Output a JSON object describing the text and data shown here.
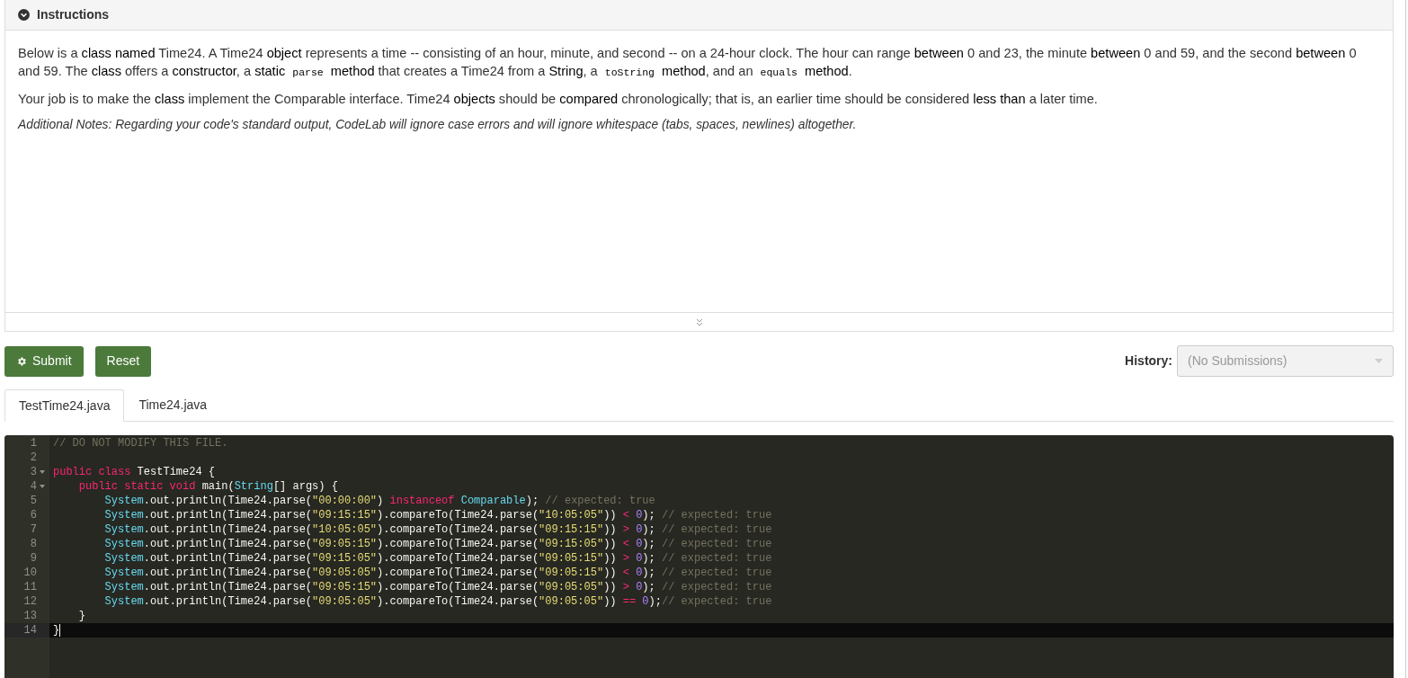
{
  "instructions": {
    "title": "Instructions",
    "paragraphs": [
      {
        "italic": false,
        "segments": [
          {
            "kind": "text",
            "text": "Below is a **class named** Time24. A Time24 **object** represents a time -- consisting of an hour, minute, and second -- on a 24-hour clock. The hour can range **between** 0 and 23, the minute **between** 0 and 59, and the second **between** 0 and 59. The **class** offers a **constructor**, a **static** "
          },
          {
            "kind": "code",
            "text": "parse"
          },
          {
            "kind": "text",
            "text": " **method** that creates a Time24 from a **String**, a "
          },
          {
            "kind": "code",
            "text": "toString"
          },
          {
            "kind": "text",
            "text": " **method**, and an "
          },
          {
            "kind": "code",
            "text": "equals"
          },
          {
            "kind": "text",
            "text": " **method**."
          }
        ]
      },
      {
        "italic": false,
        "segments": [
          {
            "kind": "text",
            "text": "Your job is to make the **class** implement the Comparable interface. Time24 **objects** should be **compared** chronologically; that is, an earlier time should be considered **less than** a later time."
          }
        ]
      },
      {
        "italic": true,
        "segments": [
          {
            "kind": "text",
            "text": "Additional Notes: Regarding your code's standard output, CodeLab will ignore case errors and will ignore whitespace (tabs, spaces, newlines) altogether."
          }
        ]
      }
    ]
  },
  "buttons": [
    {
      "label": "Submit",
      "kind": "gear"
    },
    {
      "label": "Reset",
      "kind": "plain"
    }
  ],
  "history": {
    "label": "History:",
    "placeholder": "(No Submissions)",
    "disabled": true
  },
  "tabs": [
    {
      "label": "TestTime24.java",
      "selected": true
    },
    {
      "label": "Time24.java",
      "selected": false
    }
  ],
  "editor": {
    "lines": [
      {
        "number": "1",
        "fold": false,
        "active": false,
        "tokens": [
          {
            "t": "// DO NOT MODIFY THIS FILE.",
            "kind": "comment"
          }
        ]
      },
      {
        "number": "2",
        "fold": false,
        "active": false
      },
      {
        "number": "3",
        "fold": true,
        "active": false,
        "tokens": [
          {
            "t": "public class",
            "kind": "keyword"
          },
          {
            "t": " TestTime24 {",
            "kind": "plain"
          }
        ]
      },
      {
        "number": "4",
        "fold": true,
        "active": false,
        "tokens": [
          {
            "t": "    public static void",
            "kind": "keyword"
          },
          {
            "t": " main(",
            "kind": "plain"
          },
          {
            "t": "String",
            "kind": "type"
          },
          {
            "t": "[] args) {",
            "kind": "plain"
          }
        ]
      },
      {
        "number": "5",
        "fold": false,
        "active": false,
        "tokens": [
          {
            "t": "        System",
            "kind": "type"
          },
          {
            "t": ".out.println(Time24.parse(",
            "kind": "plain"
          },
          {
            "t": "\"00:00:00\"",
            "kind": "string"
          },
          {
            "t": ") ",
            "kind": "plain"
          },
          {
            "t": "instanceof ",
            "kind": "keyword"
          },
          {
            "t": "Comparable",
            "kind": "type"
          },
          {
            "t": "); ",
            "kind": "plain"
          },
          {
            "t": "// expected: true",
            "kind": "comment"
          }
        ]
      },
      {
        "number": "6",
        "fold": false,
        "active": false,
        "tokens": [
          {
            "t": "        System",
            "kind": "type"
          },
          {
            "t": ".out.println(Time24.parse(",
            "kind": "plain"
          },
          {
            "t": "\"09:15:15\"",
            "kind": "string"
          },
          {
            "t": ").compareTo(Time24.parse(",
            "kind": "plain"
          },
          {
            "t": "\"10:05:05\"",
            "kind": "string"
          },
          {
            "t": ")) ",
            "kind": "plain"
          },
          {
            "t": "< ",
            "kind": "keyword"
          },
          {
            "t": "0",
            "kind": "number"
          },
          {
            "t": "); ",
            "kind": "plain"
          },
          {
            "t": "// expected: true",
            "kind": "comment"
          }
        ]
      },
      {
        "number": "7",
        "fold": false,
        "active": false,
        "tokens": [
          {
            "t": "        System",
            "kind": "type"
          },
          {
            "t": ".out.println(Time24.parse(",
            "kind": "plain"
          },
          {
            "t": "\"10:05:05\"",
            "kind": "string"
          },
          {
            "t": ").compareTo(Time24.parse(",
            "kind": "plain"
          },
          {
            "t": "\"09:15:15\"",
            "kind": "string"
          },
          {
            "t": ")) ",
            "kind": "plain"
          },
          {
            "t": "> ",
            "kind": "keyword"
          },
          {
            "t": "0",
            "kind": "number"
          },
          {
            "t": "); ",
            "kind": "plain"
          },
          {
            "t": "// expected: true",
            "kind": "comment"
          }
        ]
      },
      {
        "number": "8",
        "fold": false,
        "active": false,
        "tokens": [
          {
            "t": "        System",
            "kind": "type"
          },
          {
            "t": ".out.println(Time24.parse(",
            "kind": "plain"
          },
          {
            "t": "\"09:05:15\"",
            "kind": "string"
          },
          {
            "t": ").compareTo(Time24.parse(",
            "kind": "plain"
          },
          {
            "t": "\"09:15:05\"",
            "kind": "string"
          },
          {
            "t": ")) ",
            "kind": "plain"
          },
          {
            "t": "< ",
            "kind": "keyword"
          },
          {
            "t": "0",
            "kind": "number"
          },
          {
            "t": "); ",
            "kind": "plain"
          },
          {
            "t": "// expected: true",
            "kind": "comment"
          }
        ]
      },
      {
        "number": "9",
        "fold": false,
        "active": false,
        "tokens": [
          {
            "t": "        System",
            "kind": "type"
          },
          {
            "t": ".out.println(Time24.parse(",
            "kind": "plain"
          },
          {
            "t": "\"09:15:05\"",
            "kind": "string"
          },
          {
            "t": ").compareTo(Time24.parse(",
            "kind": "plain"
          },
          {
            "t": "\"09:05:15\"",
            "kind": "string"
          },
          {
            "t": ")) ",
            "kind": "plain"
          },
          {
            "t": "> ",
            "kind": "keyword"
          },
          {
            "t": "0",
            "kind": "number"
          },
          {
            "t": "); ",
            "kind": "plain"
          },
          {
            "t": "// expected: true",
            "kind": "comment"
          }
        ]
      },
      {
        "number": "10",
        "fold": false,
        "active": false,
        "tokens": [
          {
            "t": "        System",
            "kind": "type"
          },
          {
            "t": ".out.println(Time24.parse(",
            "kind": "plain"
          },
          {
            "t": "\"09:05:05\"",
            "kind": "string"
          },
          {
            "t": ").compareTo(Time24.parse(",
            "kind": "plain"
          },
          {
            "t": "\"09:05:15\"",
            "kind": "string"
          },
          {
            "t": ")) ",
            "kind": "plain"
          },
          {
            "t": "< ",
            "kind": "keyword"
          },
          {
            "t": "0",
            "kind": "number"
          },
          {
            "t": "); ",
            "kind": "plain"
          },
          {
            "t": "// expected: true",
            "kind": "comment"
          }
        ]
      },
      {
        "number": "11",
        "fold": false,
        "active": false,
        "tokens": [
          {
            "t": "        System",
            "kind": "type"
          },
          {
            "t": ".out.println(Time24.parse(",
            "kind": "plain"
          },
          {
            "t": "\"09:05:15\"",
            "kind": "string"
          },
          {
            "t": ").compareTo(Time24.parse(",
            "kind": "plain"
          },
          {
            "t": "\"09:05:05\"",
            "kind": "string"
          },
          {
            "t": ")) ",
            "kind": "plain"
          },
          {
            "t": "> ",
            "kind": "keyword"
          },
          {
            "t": "0",
            "kind": "number"
          },
          {
            "t": "); ",
            "kind": "plain"
          },
          {
            "t": "// expected: true",
            "kind": "comment"
          }
        ]
      },
      {
        "number": "12",
        "fold": false,
        "active": false,
        "tokens": [
          {
            "t": "        System",
            "kind": "type"
          },
          {
            "t": ".out.println(Time24.parse(",
            "kind": "plain"
          },
          {
            "t": "\"09:05:05\"",
            "kind": "string"
          },
          {
            "t": ").compareTo(Time24.parse(",
            "kind": "plain"
          },
          {
            "t": "\"09:05:05\"",
            "kind": "string"
          },
          {
            "t": ")) ",
            "kind": "plain"
          },
          {
            "t": "== ",
            "kind": "keyword"
          },
          {
            "t": "0",
            "kind": "number"
          },
          {
            "t": ");",
            "kind": "plain"
          },
          {
            "t": "// expected: true",
            "kind": "comment"
          }
        ]
      },
      {
        "number": "13",
        "fold": false,
        "active": false,
        "tokens": [
          {
            "t": "    }",
            "kind": "plain"
          }
        ]
      },
      {
        "number": "14",
        "fold": false,
        "active": true,
        "tokens": [
          {
            "t": "}",
            "kind": "plain"
          }
        ]
      }
    ]
  }
}
